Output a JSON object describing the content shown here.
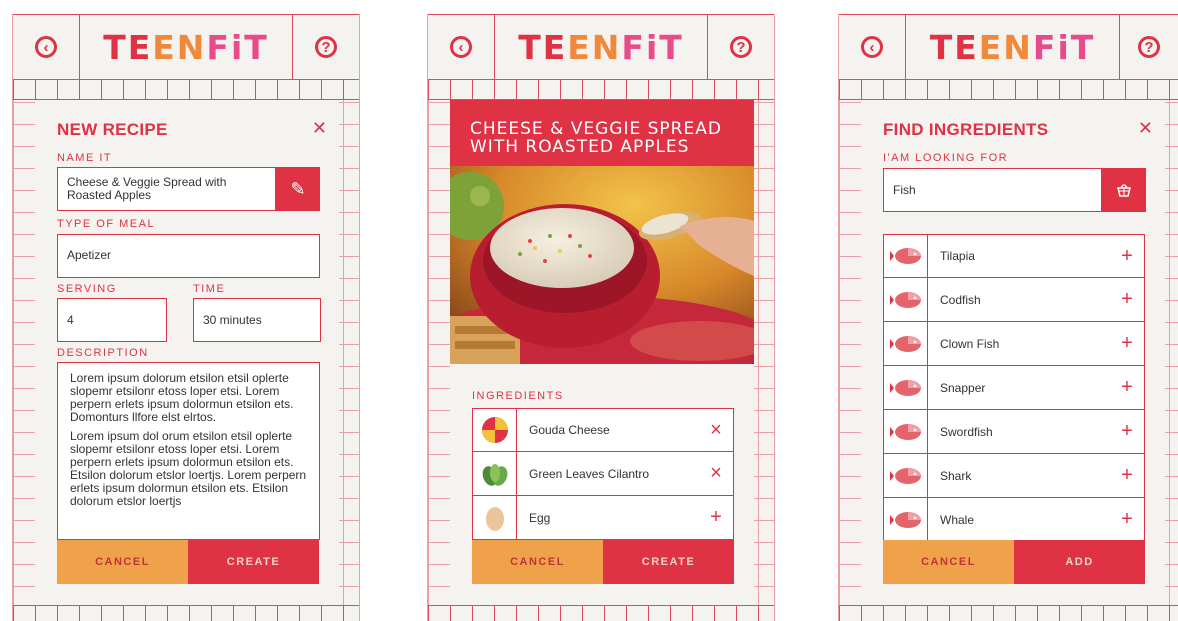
{
  "brand": {
    "logo_part1": "TE",
    "logo_part2": "EN",
    "logo_part3": "FiT"
  },
  "icons": {
    "back": "back-arrow-icon",
    "help": "question-icon",
    "close": "close-icon"
  },
  "colors": {
    "primary": "#e03245",
    "accent": "#f0a24a",
    "grid": "#e8a0a8",
    "background": "#f5f3f0"
  },
  "new_recipe": {
    "title": "NEW RECIPE",
    "name_label": "NAME IT",
    "name_value": "Cheese & Veggie Spread with Roasted Apples",
    "meal_label": "TYPE OF MEAL",
    "meal_value": "Apetizer",
    "serving_label": "SERVING",
    "serving_value": "4",
    "time_label": "TIME",
    "time_value": "30 minutes",
    "description_label": "DESCRIPTION",
    "description_p1": "Lorem ipsum dolorum etsilon etsil oplerte slopemr etsilonr etoss loper etsi. Lorem perpern erlets ipsum dolormun etsilon ets. Domonturs llfore elst elrtos.",
    "description_p2": "Lorem ipsum dol orum etsilon etsil oplerte slopemr etsilonr etoss loper etsi. Lorem perpern erlets ipsum dolormun etsilon ets. Etsilon dolorum etslor loertjs. Lorem perpern erlets ipsum dolormun etsilon ets. Etsilon dolorum etslor loertjs",
    "cancel_label": "CANCEL",
    "create_label": "CREATE"
  },
  "recipe_detail": {
    "title_line1": "CHEESE & VEGGIE SPREAD",
    "title_line2": "WITH ROASTED APPLES",
    "ingredients_label": "INGREDIENTS",
    "ingredients": [
      {
        "name": "Gouda Cheese",
        "action": "×",
        "icon": "cheese-icon"
      },
      {
        "name": "Green Leaves Cilantro",
        "action": "×",
        "icon": "leaves-icon"
      },
      {
        "name": "Egg",
        "action": "+",
        "icon": "egg-icon"
      }
    ],
    "cancel_label": "CANCEL",
    "create_label": "CREATE"
  },
  "find_ingredients": {
    "title": "FIND INGREDIENTS",
    "search_label": "I'AM LOOKING FOR",
    "search_value": "Fish",
    "results": [
      {
        "name": "Tilapia",
        "action": "+",
        "icon": "fish-icon"
      },
      {
        "name": "Codfish",
        "action": "+",
        "icon": "fish-icon"
      },
      {
        "name": "Clown Fish",
        "action": "+",
        "icon": "fish-icon"
      },
      {
        "name": "Snapper",
        "action": "+",
        "icon": "fish-icon"
      },
      {
        "name": "Swordfish",
        "action": "+",
        "icon": "fish-icon"
      },
      {
        "name": "Shark",
        "action": "+",
        "icon": "fish-icon"
      },
      {
        "name": "Whale",
        "action": "+",
        "icon": "fish-icon"
      }
    ],
    "cancel_label": "CANCEL",
    "add_label": "ADD"
  },
  "misc": {
    "back_glyph": "‹",
    "help_glyph": "?",
    "close_glyph": "✕",
    "pencil_glyph": "✎"
  }
}
